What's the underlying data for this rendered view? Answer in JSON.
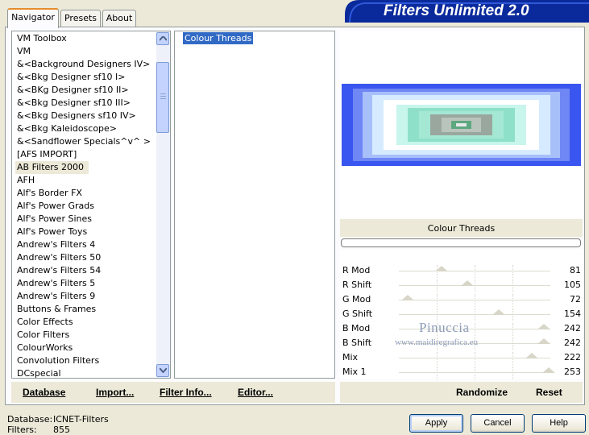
{
  "header": {
    "title": "Filters Unlimited 2.0"
  },
  "tabs": [
    {
      "label": "Navigator"
    },
    {
      "label": "Presets"
    },
    {
      "label": "About"
    }
  ],
  "category_list": {
    "items": [
      "VM Toolbox",
      "VM",
      "&<Background Designers IV>",
      "&<Bkg Designer sf10 I>",
      "&<BKg Designer sf10 II>",
      "&<Bkg Designer sf10 III>",
      "&<Bkg Designers sf10 IV>",
      "&<Bkg Kaleidoscope>",
      "&<Sandflower Specials^v^ >",
      "[AFS IMPORT]",
      "AB Filters 2000",
      "AFH",
      "Alf's Border FX",
      "Alf's Power Grads",
      "Alf's Power Sines",
      "Alf's Power Toys",
      "Andrew's Filters 4",
      "Andrew's Filters 50",
      "Andrew's Filters 54",
      "Andrew's Filters 5",
      "Andrew's Filters 9",
      "Buttons & Frames",
      "Color Effects",
      "Color Filters",
      "ColourWorks",
      "Convolution Filters",
      "DCspecial"
    ],
    "selected": "AB Filters 2000"
  },
  "filter_list": {
    "items": [
      "Colour Threads"
    ],
    "selected": "Colour Threads"
  },
  "preview": {
    "filter_name": "Colour Threads",
    "colors": [
      "#3a56f0",
      "#6f86f5",
      "#a8c0fa",
      "#d6ebff",
      "#ffffff",
      "#c8f5ec",
      "#8fe0c8",
      "#9aa79f",
      "#5da880",
      "#e8e8e8"
    ]
  },
  "watermark": {
    "name": "Pinuccia",
    "url": "www.maidiregrafica.eu"
  },
  "params": [
    {
      "label": "R Mod",
      "value": "81"
    },
    {
      "label": "R Shift",
      "value": "105"
    },
    {
      "label": "G Mod",
      "value": "72"
    },
    {
      "label": "G Shift",
      "value": "154"
    },
    {
      "label": "B Mod",
      "value": "242"
    },
    {
      "label": "B Shift",
      "value": "242"
    },
    {
      "label": "Mix",
      "value": "222"
    },
    {
      "label": "Mix 1",
      "value": "253"
    }
  ],
  "bottom_links": {
    "database": "Database",
    "import": "Import...",
    "filter_info": "Filter Info...",
    "editor": "Editor...",
    "randomize": "Randomize",
    "reset": "Reset"
  },
  "status": {
    "database_label": "Database:",
    "database_value": "ICNET-Filters",
    "filters_label": "Filters:",
    "filters_value": "855"
  },
  "buttons": {
    "apply": "Apply",
    "cancel": "Cancel",
    "help": "Help"
  }
}
